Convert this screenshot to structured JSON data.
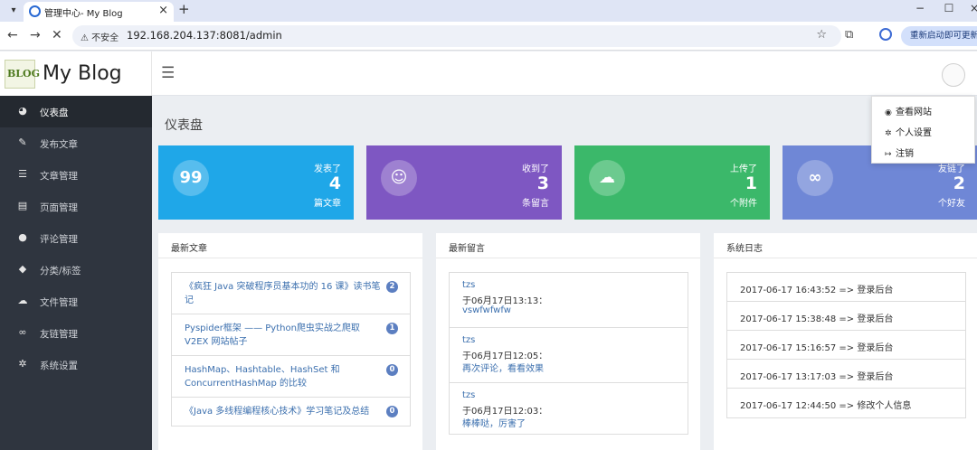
{
  "browser": {
    "tab_title": "管理中心- My Blog",
    "security_label": "⚠ 不安全",
    "url": "192.168.204.137:8081/admin",
    "update_button": "重新启动即可更新"
  },
  "header": {
    "logo_text": "BLOG",
    "title": "My Blog"
  },
  "sidebar": {
    "items": [
      {
        "label": "仪表盘",
        "icon": "dashboard-icon",
        "glyph": "◕"
      },
      {
        "label": "发布文章",
        "icon": "edit-icon",
        "glyph": "✎"
      },
      {
        "label": "文章管理",
        "icon": "list-icon",
        "glyph": "☰"
      },
      {
        "label": "页面管理",
        "icon": "file-icon",
        "glyph": "▤"
      },
      {
        "label": "评论管理",
        "icon": "comments-icon",
        "glyph": "●"
      },
      {
        "label": "分类/标签",
        "icon": "tags-icon",
        "glyph": "◆"
      },
      {
        "label": "文件管理",
        "icon": "cloud-icon",
        "glyph": "☁"
      },
      {
        "label": "友链管理",
        "icon": "link-icon",
        "glyph": "∞"
      },
      {
        "label": "系统设置",
        "icon": "gear-icon",
        "glyph": "✲"
      }
    ]
  },
  "page_title": "仪表盘",
  "stats": [
    {
      "top": "发表了",
      "num": "4",
      "bottom": "篇文章",
      "color": "#1fa7e8",
      "glyph": "99",
      "icon": "quote-icon"
    },
    {
      "top": "收到了",
      "num": "3",
      "bottom": "条留言",
      "color": "#7e57c2",
      "glyph": "☺",
      "icon": "chat-icon"
    },
    {
      "top": "上传了",
      "num": "1",
      "bottom": "个附件",
      "color": "#3bb86a",
      "glyph": "☁",
      "icon": "upload-icon"
    },
    {
      "top": "友链了",
      "num": "2",
      "bottom": "个好友",
      "color": "#6f87d6",
      "glyph": "∞",
      "icon": "link-icon"
    }
  ],
  "panels": {
    "articles": {
      "title": "最新文章",
      "items": [
        {
          "title": "《疯狂 Java 突破程序员基本功的 16 课》读书笔记",
          "count": "2"
        },
        {
          "title": "Pyspider框架 —— Python爬虫实战之爬取 V2EX 网站帖子",
          "count": "1"
        },
        {
          "title": "HashMap、Hashtable、HashSet 和 ConcurrentHashMap 的比较",
          "count": "0"
        },
        {
          "title": "《Java 多线程编程核心技术》学习笔记及总结",
          "count": "0"
        }
      ]
    },
    "comments": {
      "title": "最新留言",
      "items": [
        {
          "author": "tzs",
          "time": "于06月17日13:13：",
          "text": "vswfwfwfw"
        },
        {
          "author": "tzs",
          "time": "于06月17日12:05：",
          "text": "再次评论，看看效果"
        },
        {
          "author": "tzs",
          "time": "于06月17日12:03：",
          "text": "棒棒哒，厉害了"
        }
      ]
    },
    "logs": {
      "title": "系统日志",
      "items": [
        "2017-06-17 16:43:52 => 登录后台",
        "2017-06-17 15:38:48 => 登录后台",
        "2017-06-17 15:16:57 => 登录后台",
        "2017-06-17 13:17:03 => 登录后台",
        "2017-06-17 12:44:50 => 修改个人信息"
      ]
    }
  },
  "dropdown": {
    "items": [
      {
        "label": "查看网站",
        "glyph": "◉",
        "icon": "eye-icon"
      },
      {
        "label": "个人设置",
        "glyph": "✲",
        "icon": "settings-icon"
      },
      {
        "label": "注销",
        "glyph": "↦",
        "icon": "logout-icon"
      }
    ]
  }
}
